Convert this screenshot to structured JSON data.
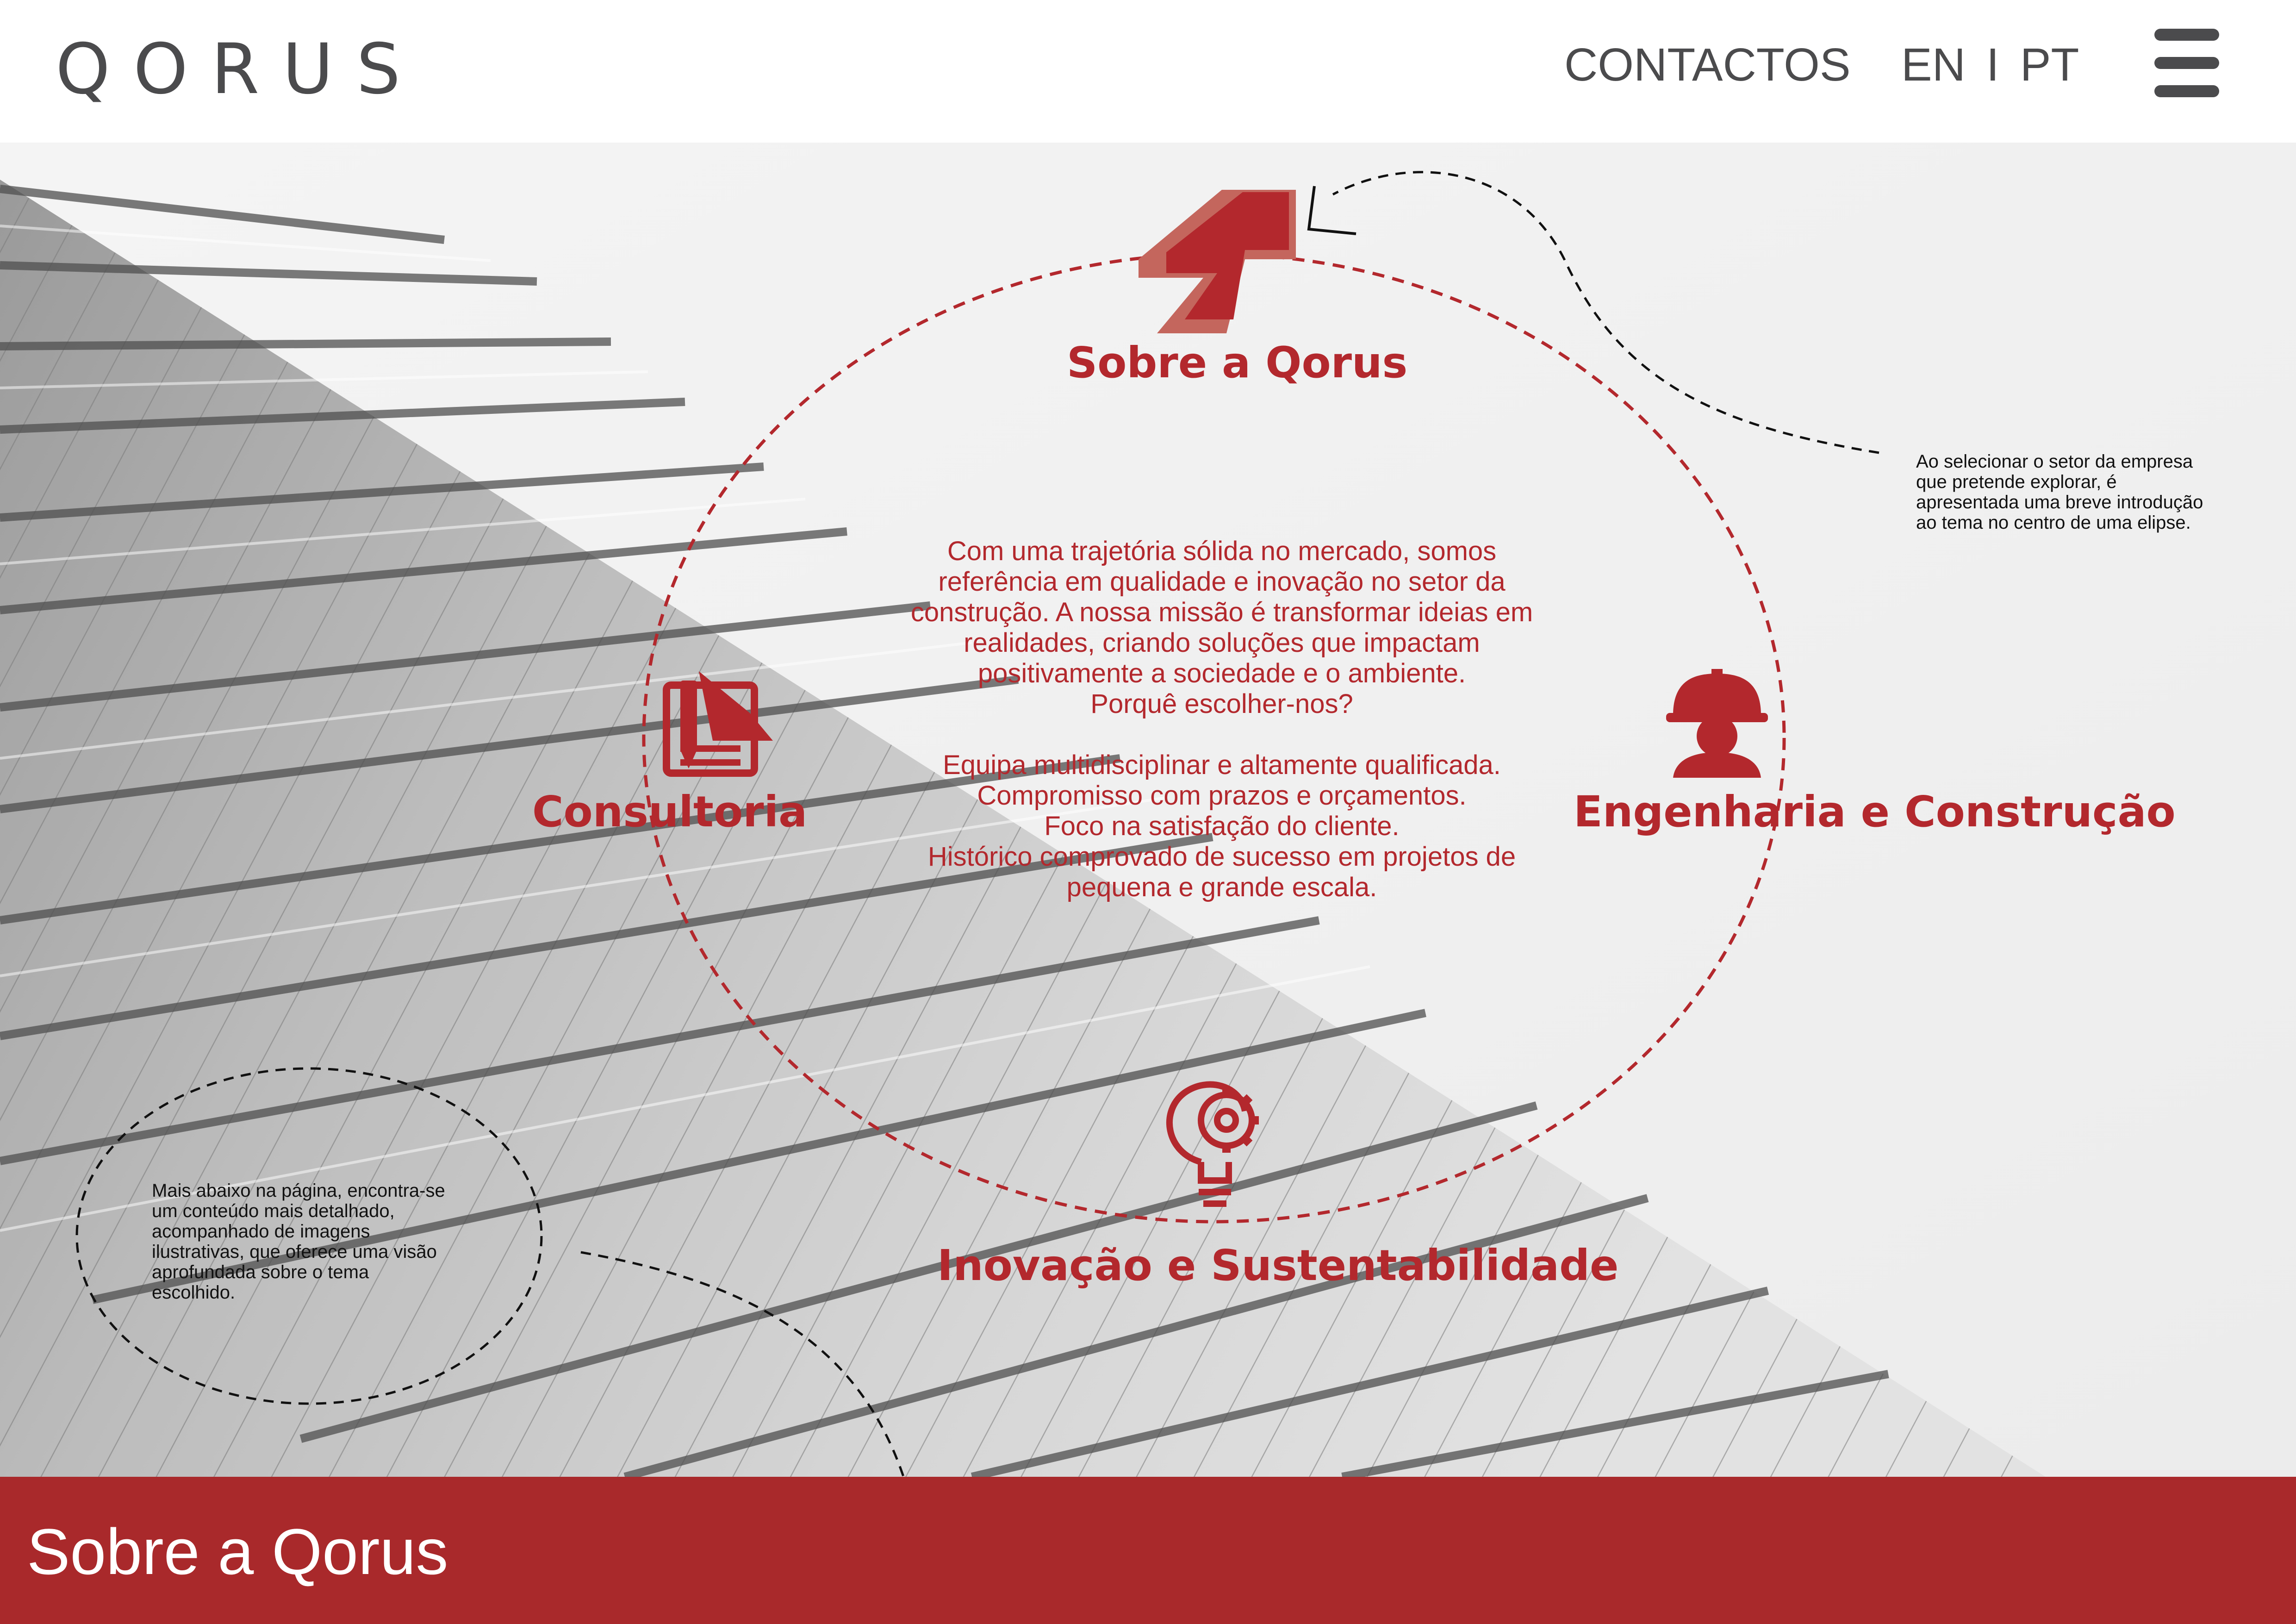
{
  "header": {
    "logo": "QORUS",
    "contacts_label": "CONTACTOS",
    "lang_en": "EN",
    "lang_separator": "I",
    "lang_pt": "PT",
    "menu_icon": "hamburger-menu-icon"
  },
  "sectors": {
    "about": {
      "label": "Sobre a Qorus",
      "icon": "arrow-up-right-logo-icon"
    },
    "consulting": {
      "label": "Consultoria",
      "icon": "document-pencil-icon"
    },
    "engineering": {
      "label": "Engenharia e Construção",
      "icon": "construction-worker-icon"
    },
    "innovation": {
      "label": "Inovação e Sustentabilidade",
      "icon": "lightbulb-gear-icon"
    }
  },
  "center_text": {
    "intro": [
      "Com uma trajetória sólida no mercado, somos",
      "referência em qualidade e inovação no setor da",
      "construção. A nossa missão é transformar ideias em",
      "realidades, criando soluções que impactam",
      "positivamente a sociedade e o ambiente.",
      "Porquê escolher-nos?"
    ],
    "points": [
      "Equipa multidisciplinar e altamente qualificada.",
      "Compromisso com prazos e orçamentos.",
      "Foco na satisfação do cliente.",
      "Histórico comprovado de sucesso em projetos de",
      "pequena e grande escala."
    ]
  },
  "annotations": {
    "top_right": [
      "Ao selecionar o setor da empresa",
      "que pretende explorar, é",
      "apresentada uma breve introdução",
      "ao tema no centro de uma elipse."
    ],
    "bottom_left": [
      "Mais abaixo na página, encontra-se",
      "um conteúdo mais detalhado,",
      "acompanhado de imagens",
      "ilustrativas, que oferece uma visão",
      "aprofundada sobre o tema",
      "escolhido."
    ]
  },
  "band": {
    "title": "Sobre a Qorus"
  },
  "colors": {
    "brand_red": "#b3282d",
    "band_red": "#a9292b",
    "text_gray": "#4b4b4d"
  }
}
